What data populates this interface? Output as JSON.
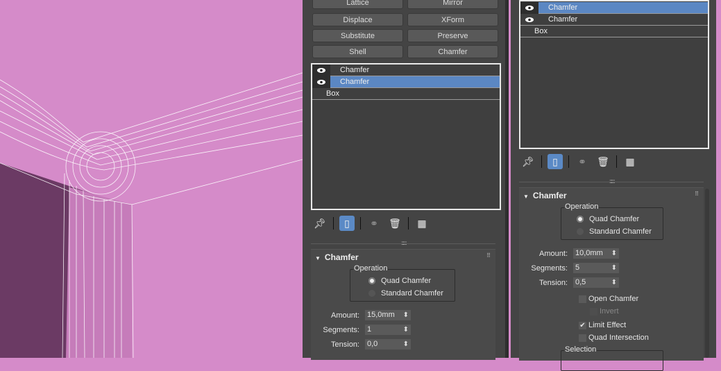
{
  "colors": {
    "viewport": "#d58bc9",
    "viewport_dark": "#6b3a64",
    "panel": "#444444",
    "selection": "#5b87c3"
  },
  "left_panel": {
    "modifier_buttons": [
      "Lattice",
      "Mirror",
      "Displace",
      "XForm",
      "Substitute",
      "Preserve",
      "Shell",
      "Chamfer"
    ],
    "stack": [
      {
        "label": "Chamfer",
        "eye": true,
        "selected": false
      },
      {
        "label": "Chamfer",
        "eye": true,
        "selected": true
      },
      {
        "label": "Box",
        "eye": false,
        "selected": false
      }
    ],
    "toolbar": [
      "pin-stack-icon",
      "show-end-result-icon",
      "make-unique-icon",
      "remove-modifier-icon",
      "configure-sets-icon"
    ],
    "rollout": {
      "title": "Chamfer",
      "operation_label": "Operation",
      "options": [
        "Quad Chamfer",
        "Standard Chamfer"
      ],
      "selected_option": "Quad Chamfer",
      "amount_label": "Amount:",
      "amount": "15,0mm",
      "segments_label": "Segments:",
      "segments": "1",
      "tension_label": "Tension:",
      "tension": "0,0"
    }
  },
  "right_panel": {
    "stack": [
      {
        "label": "Chamfer",
        "eye": true,
        "selected": true
      },
      {
        "label": "Chamfer",
        "eye": true,
        "selected": false
      },
      {
        "label": "Box",
        "eye": false,
        "selected": false
      }
    ],
    "rollout": {
      "title": "Chamfer",
      "operation_label": "Operation",
      "options": [
        "Quad Chamfer",
        "Standard Chamfer"
      ],
      "selected_option": "Quad Chamfer",
      "amount_label": "Amount:",
      "amount": "10,0mm",
      "segments_label": "Segments:",
      "segments": "5",
      "tension_label": "Tension:",
      "tension": "0,5",
      "open_chamfer": "Open Chamfer",
      "open_chamfer_checked": false,
      "invert": "Invert",
      "invert_enabled": false,
      "limit_effect": "Limit Effect",
      "limit_effect_checked": true,
      "quad_intersection": "Quad Intersection",
      "quad_intersection_checked": false,
      "selection_label": "Selection"
    }
  }
}
